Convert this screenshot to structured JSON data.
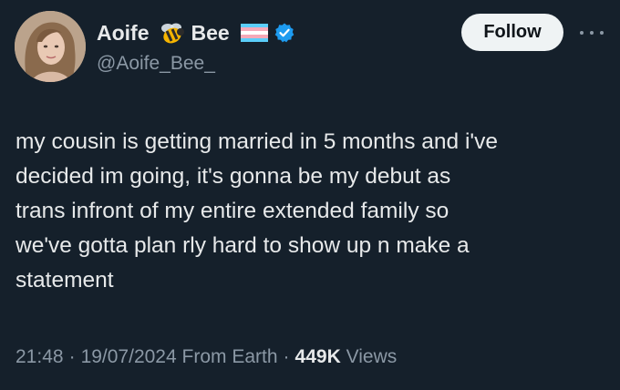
{
  "author": {
    "name_first": "Aoife",
    "name_last": "Bee",
    "handle": "@Aoife_Bee_",
    "emojis": [
      "bee-emoji",
      "transgender-flag-emoji"
    ],
    "verified": true
  },
  "follow_button": {
    "label": "Follow"
  },
  "more_button": {
    "icon": "more-horizontal-icon"
  },
  "tweet": {
    "lines": [
      "my cousin is getting married in 5 months and i've",
      "decided im going, it's gonna be my debut as",
      "trans infront of my entire extended family so",
      "we've gotta plan rly hard to show up n make a",
      "statement"
    ]
  },
  "meta": {
    "time": "21:48",
    "date": "19/07/2024",
    "source": "From Earth",
    "views_count": "449K",
    "views_label": "Views"
  },
  "colors": {
    "background": "#15202b",
    "text": "#e7e9ea",
    "secondary": "#8b98a5",
    "verified": "#1d9bf0",
    "flag_blue": "#5bcefa",
    "flag_pink": "#f5a9b8"
  }
}
